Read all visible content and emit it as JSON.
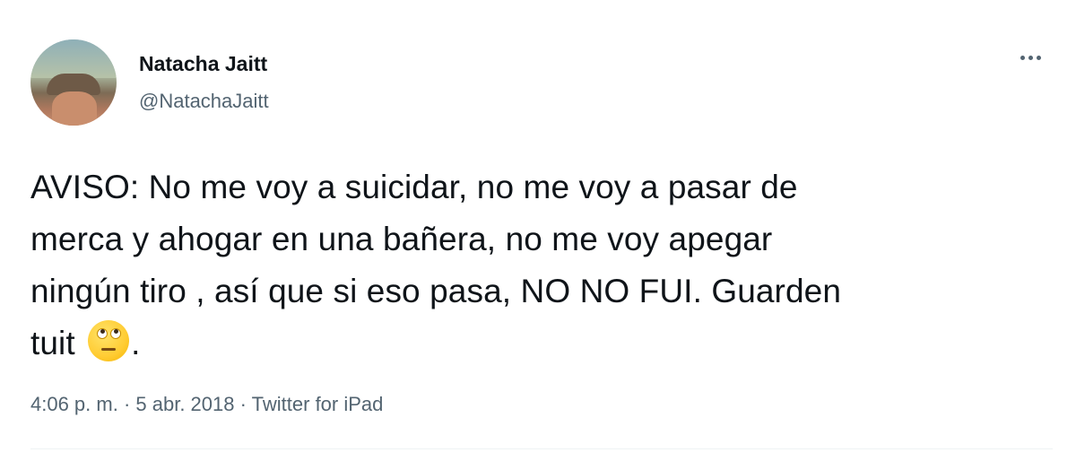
{
  "author": {
    "name": "Natacha Jaitt",
    "handle": "@NatachaJaitt",
    "avatar_icon": "profile-photo"
  },
  "more_menu_icon": "more-horizontal-icon",
  "tweet": {
    "text_line1": "AVISO: No me voy a suicidar, no me voy a pasar de",
    "text_line2": "merca y ahogar en una bañera, no me voy apegar",
    "text_line3": "ningún tiro , así que si eso pasa, NO NO FUI. Guarden",
    "text_line4_before_emoji": "tuit ",
    "emoji": "face-with-rolling-eyes",
    "text_line4_after_emoji": "."
  },
  "meta": {
    "time": "4:06 p. m.",
    "separator": " · ",
    "date": "5 abr. 2018",
    "source": "Twitter for iPad"
  }
}
